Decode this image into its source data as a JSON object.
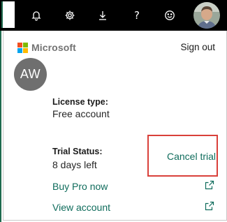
{
  "topbar": {
    "icons": {
      "notifications": "bell-icon",
      "settings": "gear-icon",
      "download": "download-icon",
      "help": "?",
      "feedback": "smiley-icon"
    }
  },
  "account_panel": {
    "brand": "Microsoft",
    "sign_out": "Sign out",
    "initials": "AW",
    "license_type_label": "License type:",
    "license_type_value": "Free account",
    "trial_status_label": "Trial Status:",
    "trial_status_value": "8 days left",
    "cancel_trial": "Cancel trial",
    "buy_pro": "Buy Pro now",
    "view_account": "View account"
  },
  "colors": {
    "brand_red": "#f25022",
    "brand_green": "#7fba00",
    "brand_blue": "#00a4ef",
    "brand_yellow": "#ffb900",
    "link_teal": "#0f6c5c",
    "highlight_red": "#d9403a"
  }
}
